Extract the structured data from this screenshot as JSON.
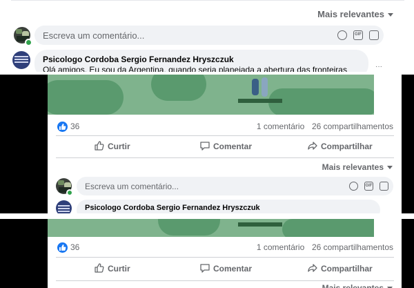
{
  "comments": {
    "sort_label": "Mais relevantes",
    "placeholder": "Escreva um comentário...",
    "author": "Psicologo Cordoba Sergio Fernandez Hryszczuk",
    "comment_text": "Olá amigos. Eu sou da Argentina, quando seria planejada a abertura das fronteiras"
  },
  "post": {
    "likes": "36",
    "comments_count": "1 comentário",
    "shares_count": "26 compartilhamentos",
    "actions": [
      "Curtir",
      "Comentar",
      "Compartilhar"
    ]
  },
  "colors": {
    "accent": "#1877f2",
    "text_secondary": "#65676b",
    "map_green": "#7fb38d",
    "map_land": "#5a9a6e",
    "online": "#31a24c"
  },
  "icons": [
    "like-icon",
    "comment-icon",
    "share-icon",
    "smiley-icon",
    "gif-icon",
    "sticker-icon",
    "chevron-down-icon"
  ]
}
